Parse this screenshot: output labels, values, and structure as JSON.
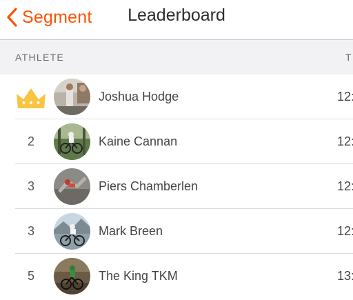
{
  "navbar": {
    "back_label": "Segment",
    "title": "Leaderboard",
    "accent_color": "#fc5200"
  },
  "columns": {
    "athlete": "ATHLETE",
    "time": "T"
  },
  "leaderboard": [
    {
      "rank": "",
      "rank_icon": "crown-icon",
      "name": "Joshua Hodge",
      "time": "12:"
    },
    {
      "rank": "2",
      "name": "Kaine Cannan",
      "time": "12:"
    },
    {
      "rank": "3",
      "name": "Piers Chamberlen",
      "time": "12:"
    },
    {
      "rank": "3",
      "name": "Mark Breen",
      "time": "12:"
    },
    {
      "rank": "5",
      "name": "The King TKM",
      "time": "13:"
    }
  ]
}
